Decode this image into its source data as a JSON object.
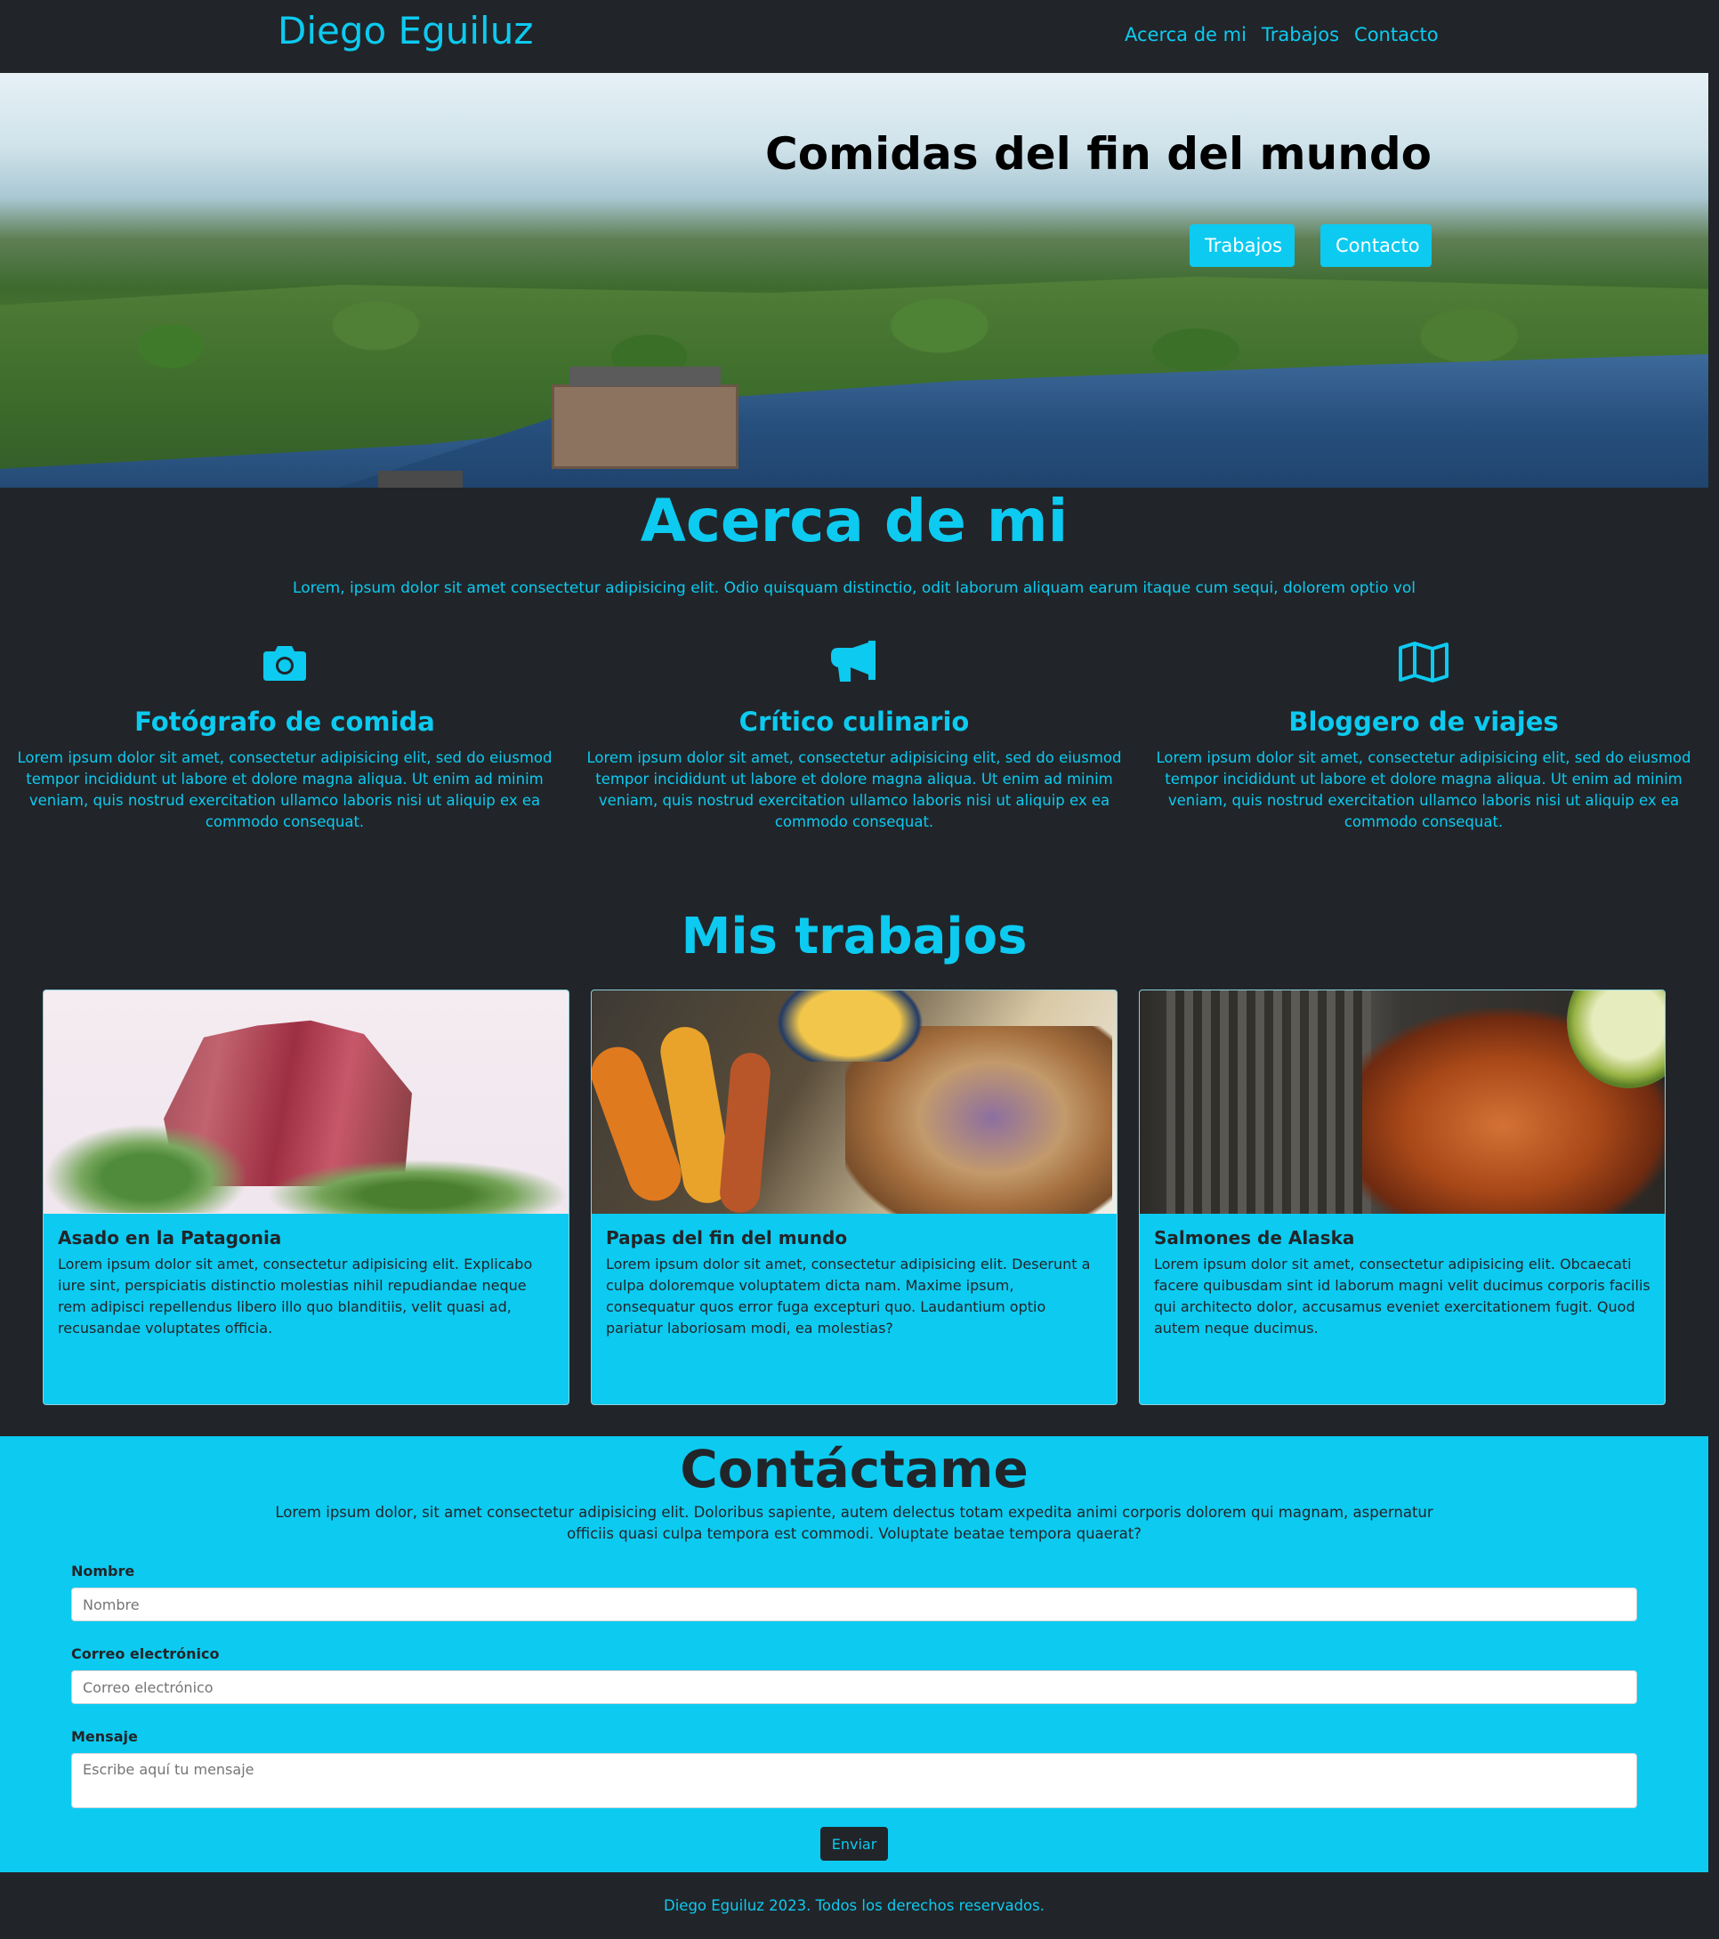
{
  "nav": {
    "brand": "Diego Eguiluz",
    "links": [
      "Acerca de mi",
      "Trabajos",
      "Contacto"
    ]
  },
  "hero": {
    "title": "Comidas del fin del mundo",
    "buttons": [
      "Trabajos",
      "Contacto"
    ]
  },
  "about": {
    "title": "Acerca de mi",
    "lead": "Lorem, ipsum dolor sit amet consectetur adipisicing elit. Odio quisquam distinctio, odit laborum aliquam earum itaque cum sequi, dolorem optio vol",
    "features": [
      {
        "icon": "camera-icon",
        "title": "Fotógrafo de comida",
        "text": "Lorem ipsum dolor sit amet, consectetur adipisicing elit, sed do eiusmod tempor incididunt ut labore et dolore magna aliqua. Ut enim ad minim veniam, quis nostrud exercitation ullamco laboris nisi ut aliquip ex ea commodo consequat."
      },
      {
        "icon": "megaphone-icon",
        "title": "Crítico culinario",
        "text": "Lorem ipsum dolor sit amet, consectetur adipisicing elit, sed do eiusmod tempor incididunt ut labore et dolore magna aliqua. Ut enim ad minim veniam, quis nostrud exercitation ullamco laboris nisi ut aliquip ex ea commodo consequat."
      },
      {
        "icon": "map-icon",
        "title": "Bloggero de viajes",
        "text": "Lorem ipsum dolor sit amet, consectetur adipisicing elit, sed do eiusmod tempor incididunt ut labore et dolore magna aliqua. Ut enim ad minim veniam, quis nostrud exercitation ullamco laboris nisi ut aliquip ex ea commodo consequat."
      }
    ]
  },
  "works": {
    "title": "Mis trabajos",
    "cards": [
      {
        "title": "Asado en la Patagonia",
        "text": "Lorem ipsum dolor sit amet, consectetur adipisicing elit. Explicabo iure sint, perspiciatis distinctio molestias nihil repudiandae neque rem adipisci repellendus libero illo quo blanditiis, velit quasi ad, recusandae voluptates officia."
      },
      {
        "title": "Papas del fin del mundo",
        "text": "Lorem ipsum dolor sit amet, consectetur adipisicing elit. Deserunt a culpa doloremque voluptatem dicta nam. Maxime ipsum, consequatur quos error fuga excepturi quo. Laudantium optio pariatur laboriosam modi, ea molestias?"
      },
      {
        "title": "Salmones de Alaska",
        "text": "Lorem ipsum dolor sit amet, consectetur adipisicing elit. Obcaecati facere quibusdam sint id laborum magni velit ducimus corporis facilis qui architecto dolor, accusamus eveniet exercitationem fugit. Quod autem neque ducimus."
      }
    ]
  },
  "contact": {
    "title": "Contáctame",
    "lead": "Lorem ipsum dolor, sit amet consectetur adipisicing elit. Doloribus sapiente, autem delectus totam expedita animi corporis dolorem qui magnam, aspernatur officiis quasi culpa tempora est commodi. Voluptate beatae tempora quaerat?",
    "name_label": "Nombre",
    "name_placeholder": "Nombre",
    "email_label": "Correo electrónico",
    "email_placeholder": "Correo electrónico",
    "message_label": "Mensaje",
    "message_placeholder": "Escribe aquí tu mensaje",
    "submit": "Enviar"
  },
  "footer": {
    "text": "Diego Eguiluz 2023. Todos los derechos reservados."
  },
  "colors": {
    "primary": "#0dcaf0",
    "dark": "#212529"
  }
}
